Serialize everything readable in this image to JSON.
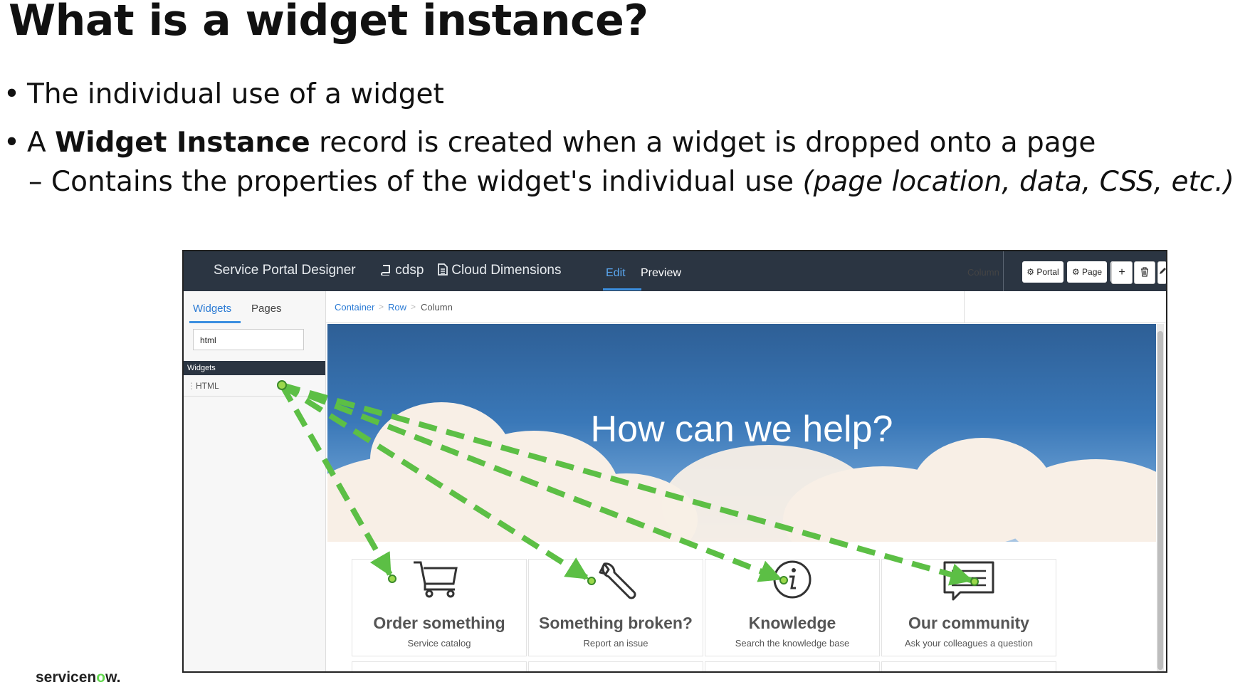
{
  "slide": {
    "title": "What is a widget instance?",
    "bullet1": "The individual use of a widget",
    "bullet2_prefix": "A ",
    "bullet2_bold": "Widget Instance",
    "bullet2_rest": " record is created when a widget is dropped onto a page",
    "sub_prefix": "– Contains the properties of the widget's individual use ",
    "sub_italic": "(page location, data, CSS, etc.)",
    "bullet_symbol": "•"
  },
  "designer": {
    "title": "Service Portal Designer",
    "portal": "cdsp",
    "page_name": "Cloud Dimensions",
    "tabs": [
      "Edit",
      "Preview"
    ],
    "active_tab": "Edit",
    "buttons": {
      "portal": "Portal",
      "page": "Page"
    }
  },
  "sidebar": {
    "tabs": [
      "Widgets",
      "Pages"
    ],
    "search_value": "html",
    "section_header": "Widgets",
    "items": [
      "HTML"
    ]
  },
  "breadcrumb": {
    "items": [
      "Container",
      "Row",
      "Column"
    ],
    "separator": ">"
  },
  "column_panel": {
    "label": "Column"
  },
  "hero": {
    "text": "How can we help?"
  },
  "cards": [
    {
      "title": "Order something",
      "desc": "Service catalog",
      "icon": "cart-icon"
    },
    {
      "title": "Something broken?",
      "desc": "Report an issue",
      "icon": "wrench-icon"
    },
    {
      "title": "Knowledge",
      "desc": "Search the knowledge base",
      "icon": "info-icon"
    },
    {
      "title": "Our community",
      "desc": "Ask your colleagues a question",
      "icon": "chat-icon"
    }
  ],
  "colors": {
    "arrow": "#5cbf45",
    "topbar": "#2b3542",
    "link": "#2a7ad4"
  },
  "logo": {
    "pre": "servicen",
    "o": "o",
    "post": "w."
  }
}
